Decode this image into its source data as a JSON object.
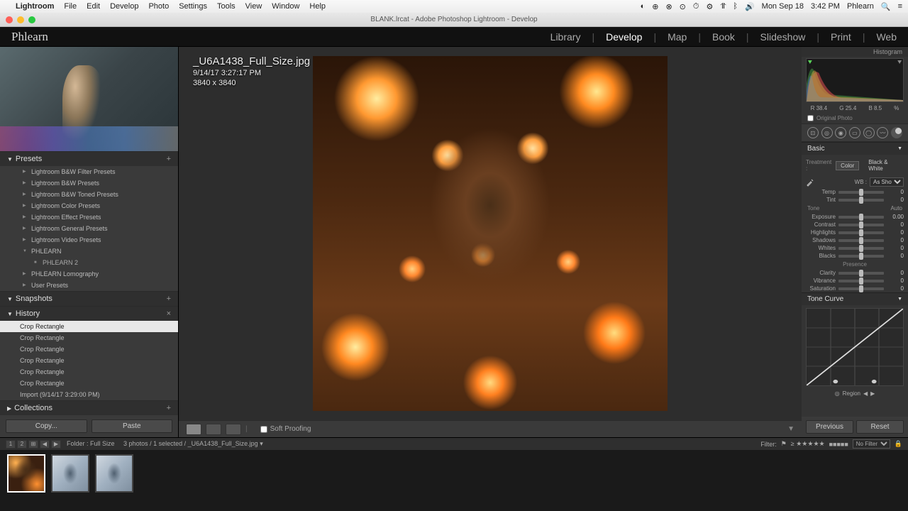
{
  "mac_menu": {
    "app": "Lightroom",
    "items": [
      "File",
      "Edit",
      "Develop",
      "Photo",
      "Settings",
      "Tools",
      "View",
      "Window",
      "Help"
    ],
    "right": {
      "date": "Mon Sep 18",
      "time": "3:42 PM",
      "user": "Phlearn"
    }
  },
  "title_bar": {
    "doc": "BLANK.lrcat - Adobe Photoshop Lightroom - Develop"
  },
  "module_bar": {
    "identity": "Phlearn",
    "modules": [
      "Library",
      "Develop",
      "Map",
      "Book",
      "Slideshow",
      "Print",
      "Web"
    ],
    "active": "Develop"
  },
  "file_info": {
    "filename": "_U6A1438_Full_Size.jpg",
    "datetime": "9/14/17 3:27:17 PM",
    "dimensions": "3840 x 3840"
  },
  "left": {
    "presets": {
      "title": "Presets",
      "items": [
        "Lightroom B&W Filter Presets",
        "Lightroom B&W Presets",
        "Lightroom B&W Toned Presets",
        "Lightroom Color Presets",
        "Lightroom Effect Presets",
        "Lightroom General Presets",
        "Lightroom Video Presets",
        "PHLEARN",
        "PHLEARN Lomography",
        "User Presets"
      ],
      "phlearn_child": "PHLEARN 2"
    },
    "snapshots": {
      "title": "Snapshots"
    },
    "history": {
      "title": "History",
      "items": [
        "Crop Rectangle",
        "Crop Rectangle",
        "Crop Rectangle",
        "Crop Rectangle",
        "Crop Rectangle",
        "Crop Rectangle",
        "Import (9/14/17 3:29:00 PM)"
      ],
      "active_index": 0
    },
    "collections": {
      "title": "Collections"
    },
    "buttons": {
      "copy": "Copy...",
      "paste": "Paste"
    }
  },
  "center_toolbar": {
    "soft_proof": "Soft Proofing"
  },
  "right": {
    "histogram_label": "Histogram",
    "histo_info": {
      "r": "R  38.4",
      "g": "G  25.4",
      "b": "B  8.5",
      "pct": "%"
    },
    "orig_photo": "Original Photo",
    "basic": "Basic",
    "treatment": {
      "label": "Treatment :",
      "color": "Color",
      "bw": "Black & White"
    },
    "wb": {
      "label": "WB :",
      "value": "As Shot"
    },
    "sliders": {
      "temp": {
        "label": "Temp",
        "val": "0"
      },
      "tint": {
        "label": "Tint",
        "val": "0"
      },
      "tone_label": "Tone",
      "auto": "Auto",
      "exposure": {
        "label": "Exposure",
        "val": "0.00"
      },
      "contrast": {
        "label": "Contrast",
        "val": "0"
      },
      "highlights": {
        "label": "Highlights",
        "val": "0"
      },
      "shadows": {
        "label": "Shadows",
        "val": "0"
      },
      "whites": {
        "label": "Whites",
        "val": "0"
      },
      "blacks": {
        "label": "Blacks",
        "val": "0"
      },
      "presence_label": "Presence",
      "clarity": {
        "label": "Clarity",
        "val": "0"
      },
      "vibrance": {
        "label": "Vibrance",
        "val": "0"
      },
      "saturation": {
        "label": "Saturation",
        "val": "0"
      }
    },
    "tone_curve": "Tone Curve",
    "region": "Region",
    "buttons": {
      "previous": "Previous",
      "reset": "Reset"
    }
  },
  "filmstrip": {
    "nav": {
      "screen1": "1",
      "screen2": "2"
    },
    "path": "Folder : Full Size",
    "count": "3 photos / 1 selected /",
    "current": "_U6A1438_Full_Size.jpg ▾",
    "filter_label": "Filter:",
    "no_filter": "No Filter"
  }
}
